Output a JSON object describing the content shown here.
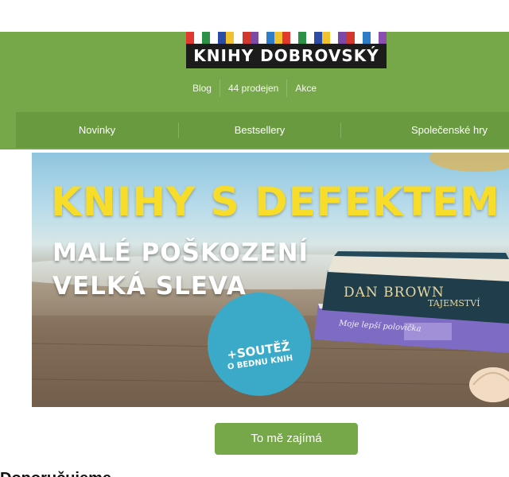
{
  "logo": {
    "text": "KNIHY DOBROVSKÝ",
    "stripe_colors": [
      "#e2382d",
      "#ffffff",
      "#2e8f46",
      "#ffffff",
      "#2b4da8",
      "#f2c12e",
      "#ffffff",
      "#d2382e",
      "#7a4aa6",
      "#ffffff",
      "#2f7cc9",
      "#f2c12e",
      "#e2382d",
      "#ffffff",
      "#2e8f46",
      "#ffffff",
      "#2b4da8",
      "#f2c12e",
      "#ffffff",
      "#7a4aa6",
      "#d2382e",
      "#ffffff",
      "#2f7cc9",
      "#ffffff",
      "#8a4fb0"
    ]
  },
  "top_links": [
    "Blog",
    "44 prodejen",
    "Akce"
  ],
  "nav": [
    "Novinky",
    "Bestsellery",
    "Společenské hry"
  ],
  "banner": {
    "title": "KNIHY S DEFEKTEM",
    "subtitle_1": "MALÉ POŠKOZENÍ",
    "subtitle_2": "VELKÁ SLEVA",
    "badge_line_1": "+SOUTĚŽ",
    "badge_line_2": "O BEDNU KNIH",
    "book_1_author": "DAN BROWN",
    "book_1_title": "TAJEMSTVÍ",
    "book_2_title": "Moje lepší polovička"
  },
  "cta_label": "To mě zajímá",
  "section_title": "Doporučujeme",
  "colors": {
    "header_green": "#76a84a",
    "nav_green": "#6a9a40",
    "title_yellow": "#f7dc2a",
    "badge_blue": "#3aaac8"
  }
}
